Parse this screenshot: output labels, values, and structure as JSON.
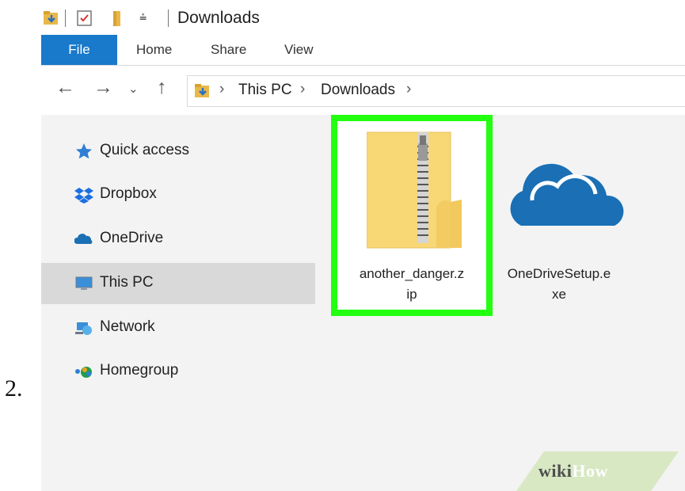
{
  "step_number": "2.",
  "window": {
    "title": "Downloads",
    "ribbon_tabs": [
      "File",
      "Home",
      "Share",
      "View"
    ],
    "breadcrumb": [
      "This PC",
      "Downloads"
    ],
    "sidebar_items": [
      {
        "label": "Quick access",
        "icon": "star-icon"
      },
      {
        "label": "Dropbox",
        "icon": "dropbox-icon"
      },
      {
        "label": "OneDrive",
        "icon": "onedrive-icon"
      },
      {
        "label": "This PC",
        "icon": "computer-icon",
        "selected": true
      },
      {
        "label": "Network",
        "icon": "network-icon"
      },
      {
        "label": "Homegroup",
        "icon": "homegroup-icon"
      }
    ],
    "files": [
      {
        "name_line1": "another_danger.z",
        "name_line2": "ip",
        "icon": "zip-folder-icon",
        "highlighted": true
      },
      {
        "name_line1": "OneDriveSetup.e",
        "name_line2": "xe",
        "icon": "onedrive-cloud-icon",
        "highlighted": false
      }
    ],
    "colors": {
      "file_tab": "#1979ca",
      "highlight": "#22ff11",
      "cloud": "#1a6fb5"
    }
  },
  "watermark": {
    "part1": "wiki",
    "part2": "How"
  }
}
